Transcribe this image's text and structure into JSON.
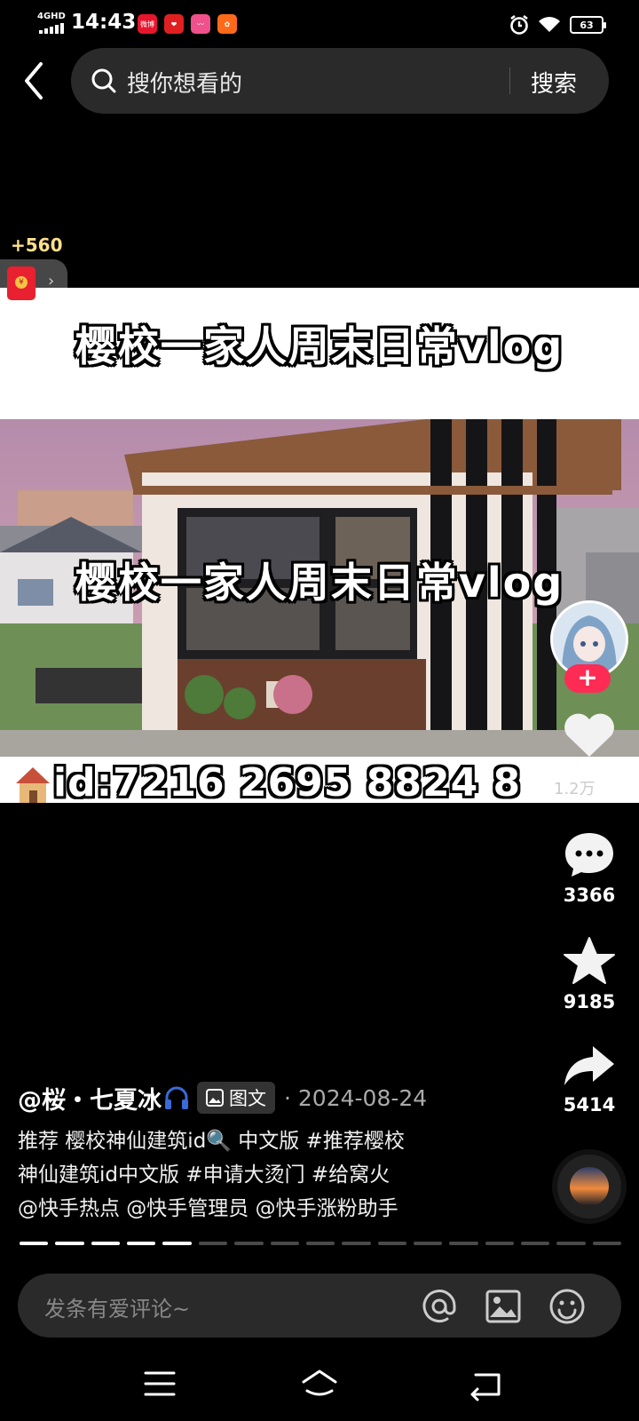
{
  "status_bar": {
    "network": "4GHD",
    "time": "14:43",
    "apps": [
      {
        "name": "app-weibo-icon",
        "color": "#e6162d",
        "text": "微博"
      },
      {
        "name": "app-heart-icon",
        "color": "#e02020",
        "text": "❤"
      },
      {
        "name": "app-live-icon",
        "color": "#f0508c",
        "text": "〰"
      },
      {
        "name": "app-kuaishou-icon",
        "color": "#ff6a1a",
        "text": "✿"
      }
    ],
    "battery": "63"
  },
  "search": {
    "placeholder": "搜你想看的",
    "button": "搜索"
  },
  "reward": {
    "amount": "+560"
  },
  "content": {
    "title": "樱校一家人周末日常vlog",
    "overlay_title": "樱校一家人周末日常vlog",
    "id_text": "id:7216 2695 8824 8"
  },
  "actions": {
    "follow": "+",
    "like_count_partial": "1.2万",
    "comments": "3366",
    "favorites": "9185",
    "shares": "5414"
  },
  "post": {
    "author": "@桜・七夏冰",
    "type_badge": "图文",
    "date": "· 2024-08-24",
    "caption_line1": "推荐 樱校神仙建筑id🔍 中文版 #推荐樱校",
    "caption_line2": "神仙建筑id中文版 #申请大烫门 #给窝火",
    "caption_line3": "@快手热点 @快手管理员 @快手涨粉助手"
  },
  "progress": {
    "total_segments": 17,
    "completed_segments": 5
  },
  "comment_bar": {
    "placeholder": "发条有爱评论~"
  }
}
